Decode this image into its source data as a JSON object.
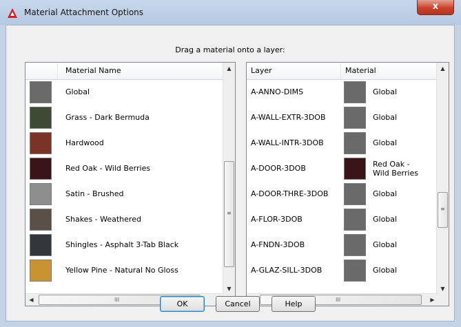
{
  "window": {
    "title": "Material Attachment Options",
    "close_label": "x",
    "instruction": "Drag a material onto a layer:"
  },
  "materials_list": {
    "column_header": "Material Name",
    "items": [
      {
        "name": "Global",
        "swatch": "#6a6a6a"
      },
      {
        "name": "Grass - Dark Bermuda",
        "swatch": "#3f4a35"
      },
      {
        "name": "Hardwood",
        "swatch": "#7b3328"
      },
      {
        "name": "Red Oak - Wild Berries",
        "swatch": "#3a1418"
      },
      {
        "name": "Satin - Brushed",
        "swatch": "#8e8e8e"
      },
      {
        "name": "Shakes - Weathered",
        "swatch": "#5a5048"
      },
      {
        "name": "Shingles - Asphalt 3-Tab Black",
        "swatch": "#33363b"
      },
      {
        "name": "Yellow Pine - Natural No Gloss",
        "swatch": "#c99232"
      }
    ],
    "scroll_up": "▲",
    "scroll_down": "▼",
    "scroll_left": "◀",
    "scroll_right": "▶",
    "h_grip": "III",
    "v_grip": "≡"
  },
  "layers_list": {
    "column_header_layer": "Layer",
    "column_header_material": "Material",
    "items": [
      {
        "layer": "A-ANNO-DIMS",
        "material": "Global",
        "swatch": "#6a6a6a"
      },
      {
        "layer": "A-WALL-EXTR-3DOB",
        "material": "Global",
        "swatch": "#6a6a6a"
      },
      {
        "layer": "A-WALL-INTR-3DOB",
        "material": "Global",
        "swatch": "#6a6a6a"
      },
      {
        "layer": "A-DOOR-3DOB",
        "material": "Red Oak - Wild Berries",
        "swatch": "#3a1418"
      },
      {
        "layer": "A-DOOR-THRE-3DOB",
        "material": "Global",
        "swatch": "#6a6a6a"
      },
      {
        "layer": "A-FLOR-3DOB",
        "material": "Global",
        "swatch": "#6a6a6a"
      },
      {
        "layer": "A-FNDN-3DOB",
        "material": "Global",
        "swatch": "#6a6a6a"
      },
      {
        "layer": "A-GLAZ-SILL-3DOB",
        "material": "Global",
        "swatch": "#6a6a6a"
      }
    ],
    "scroll_up": "▲",
    "scroll_down": "▼",
    "scroll_left": "◀",
    "scroll_right": "▶",
    "h_grip": "III",
    "v_grip": "≡"
  },
  "buttons": {
    "ok": "OK",
    "cancel": "Cancel",
    "help": "Help"
  },
  "colors": {
    "accent": "#3c7fb1",
    "close": "#c8432c",
    "app_icon": "#d11f1f"
  }
}
